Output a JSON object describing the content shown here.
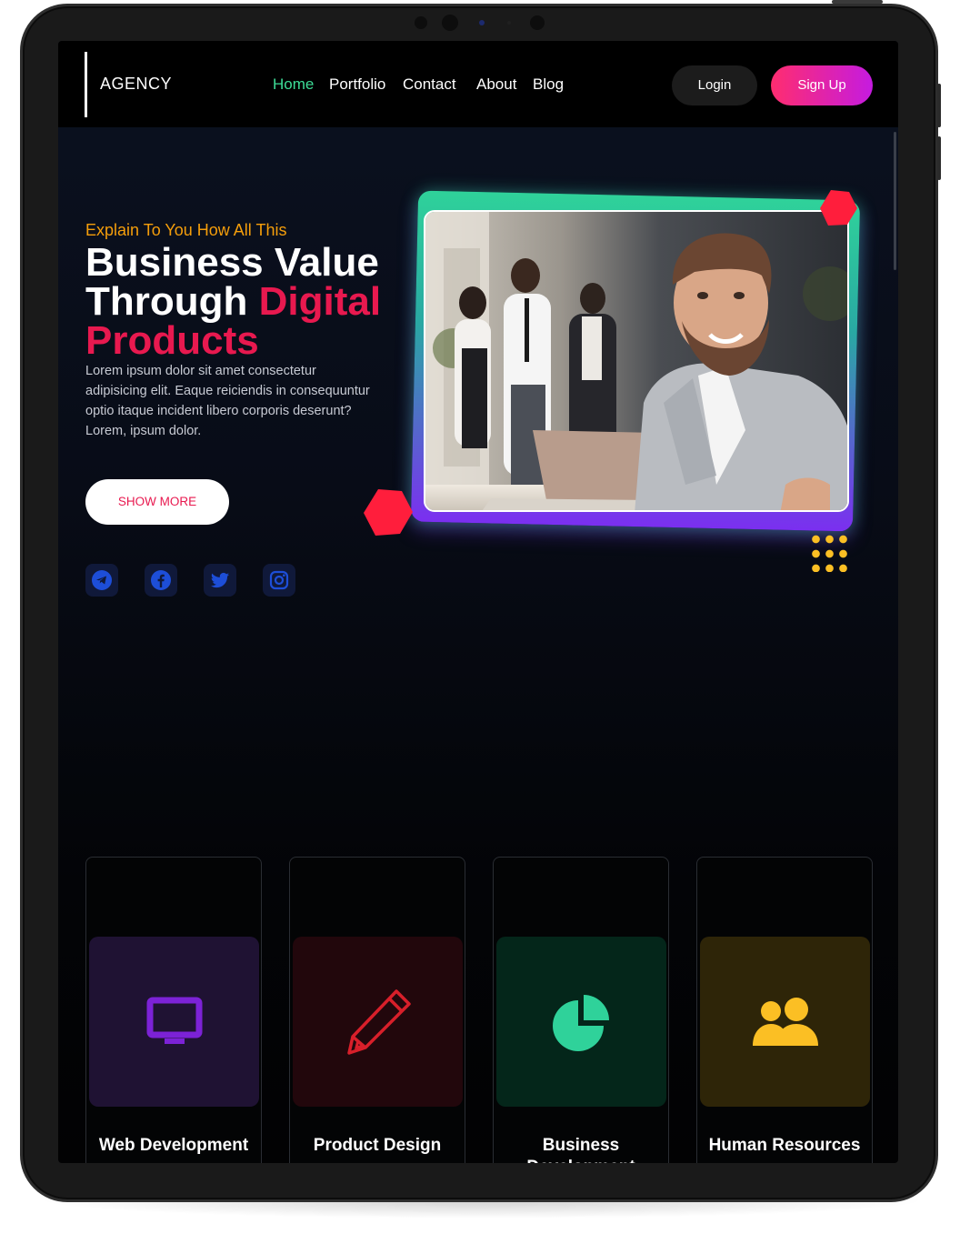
{
  "navbar": {
    "brand": "AGENCY",
    "links": [
      "Home",
      "Portfolio",
      "Contact",
      "About",
      "Blog"
    ],
    "active_link": "Home",
    "login_label": "Login",
    "signup_label": "Sign Up"
  },
  "hero": {
    "eyebrow": "Explain To You How All This",
    "title_line1": "Business Value",
    "title_line2_plain": "Through ",
    "title_line2_accent": "Digital",
    "title_line3_accent": "Products",
    "description": "Lorem ipsum dolor sit amet consectetur adipisicing elit. Eaque reiciendis in consequuntur optio itaque incident libero corporis deserunt? Lorem, ipsum dolor.",
    "cta_label": "SHOW MORE",
    "social_icons": [
      "telegram-icon",
      "facebook-icon",
      "twitter-icon",
      "instagram-icon"
    ]
  },
  "services": [
    {
      "title": "Web Development",
      "icon": "monitor-icon",
      "color": "#7c22d6",
      "bg": "#1f1233"
    },
    {
      "title": "Product Design",
      "icon": "pencil-icon",
      "color": "#d81f2a",
      "bg": "#22070c"
    },
    {
      "title": "Business Development",
      "icon": "pie-chart-icon",
      "color": "#2fd29a",
      "bg": "#04261a"
    },
    {
      "title": "Human Resources",
      "icon": "users-icon",
      "color": "#fbbf24",
      "bg": "#2e2508"
    }
  ],
  "colors": {
    "accent_green": "#3ddc97",
    "accent_pink": "#e8194f",
    "accent_orange": "#f59e0b",
    "social_blue": "#1d4ed8"
  }
}
